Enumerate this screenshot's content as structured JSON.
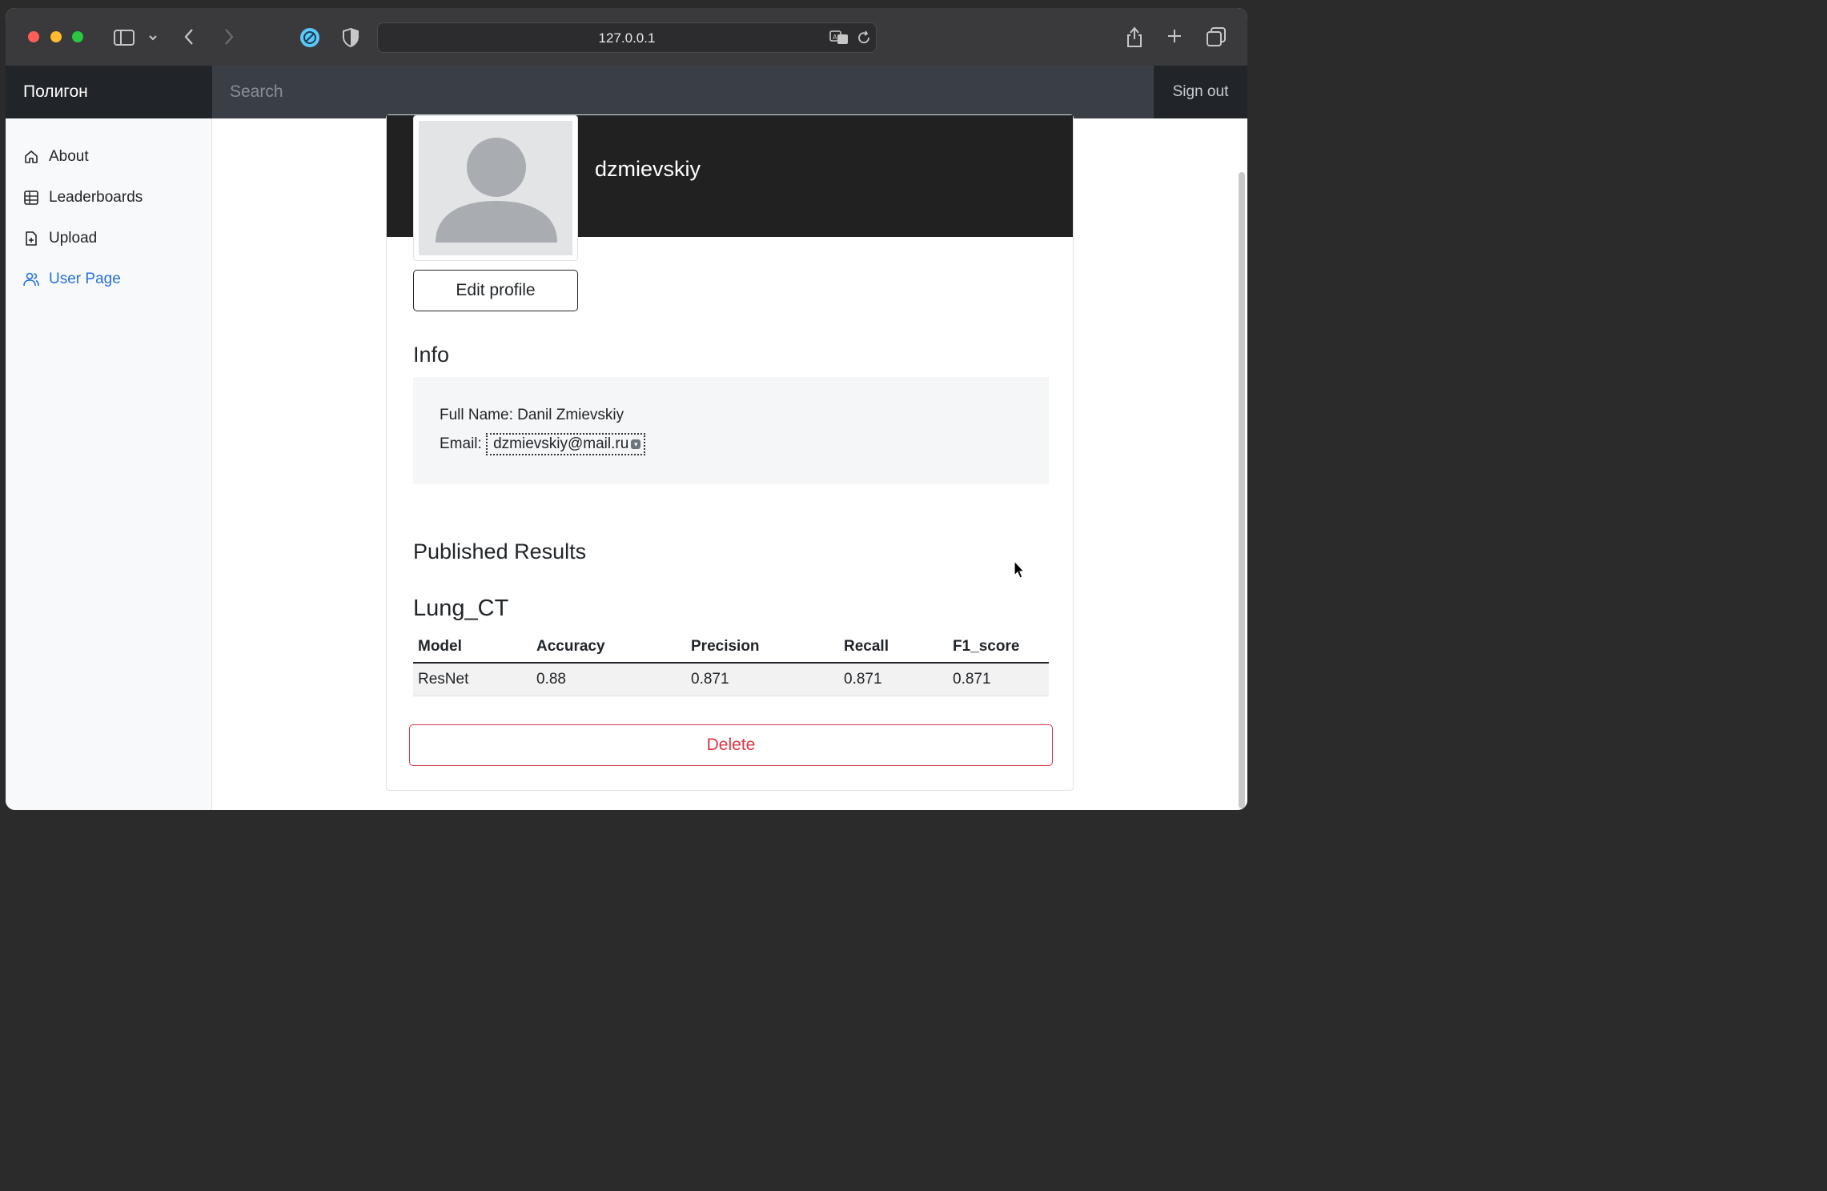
{
  "browser": {
    "url": "127.0.0.1"
  },
  "navbar": {
    "brand": "Полигон",
    "search_placeholder": "Search",
    "sign_out": "Sign out"
  },
  "sidebar": {
    "items": [
      {
        "label": "About",
        "icon": "home-icon"
      },
      {
        "label": "Leaderboards",
        "icon": "table-icon"
      },
      {
        "label": "Upload",
        "icon": "file-plus-icon"
      },
      {
        "label": "User Page",
        "icon": "users-icon",
        "active": true
      }
    ]
  },
  "profile": {
    "username": "dzmievskiy",
    "edit_button": "Edit profile",
    "info_heading": "Info",
    "full_name_line": "Full Name: Danil Zmievskiy",
    "email_label": "Email:",
    "email_value": "dzmievskiy@mail.ru"
  },
  "results": {
    "heading": "Published Results",
    "dataset": "Lung_CT",
    "columns": [
      "Model",
      "Accuracy",
      "Precision",
      "Recall",
      "F1_score"
    ],
    "rows": [
      [
        "ResNet",
        "0.88",
        "0.871",
        "0.871",
        "0.871"
      ]
    ],
    "delete_button": "Delete"
  },
  "colors": {
    "active_link": "#2470dc",
    "danger": "#dc3545",
    "navbar_bg": "#343a40",
    "header_bg": "#212121"
  }
}
